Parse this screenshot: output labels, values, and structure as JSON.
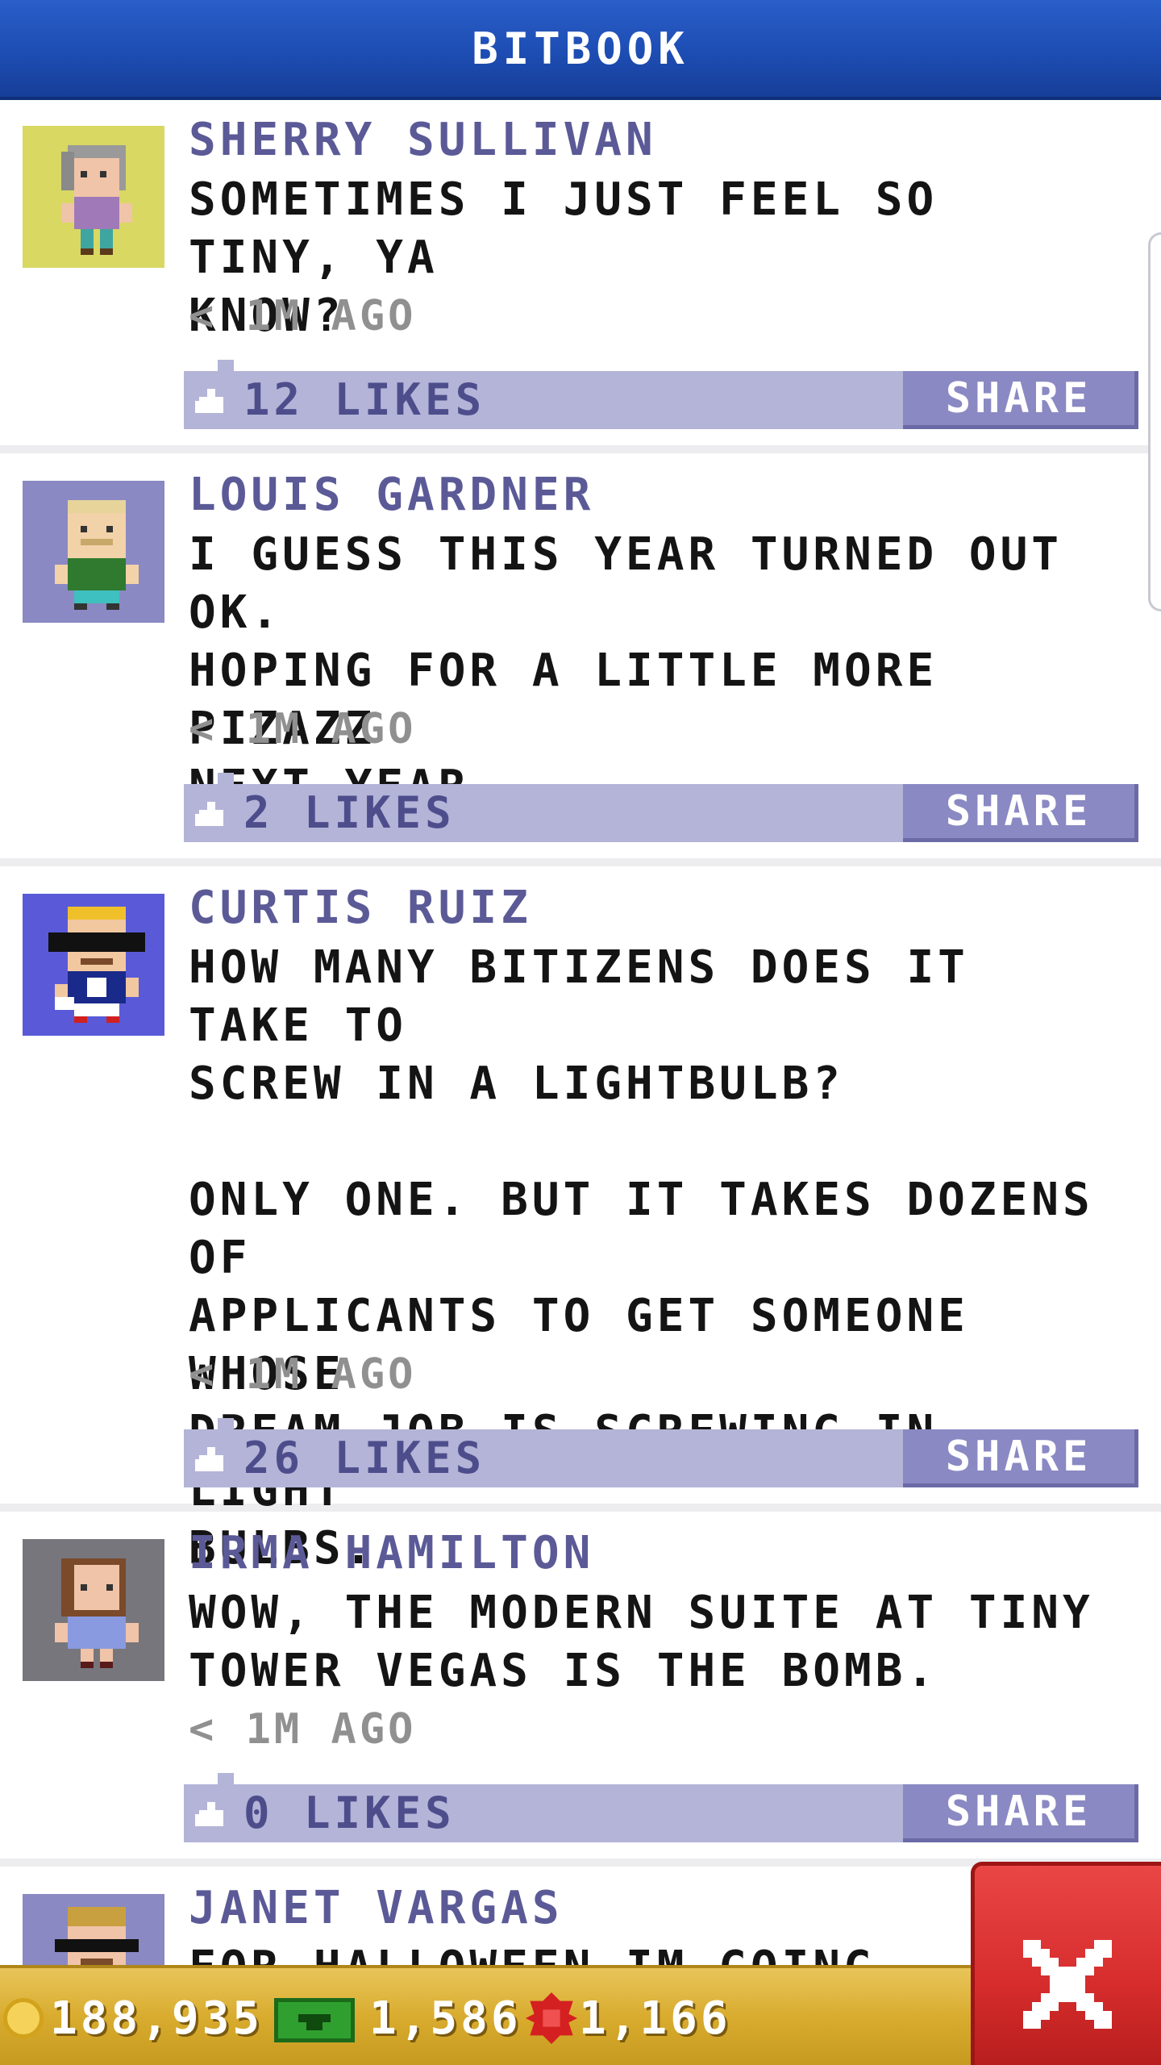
{
  "header": {
    "title": "BITBOOK"
  },
  "posts": [
    {
      "name": "SHERRY SULLIVAN",
      "text": "SOMETIMES I JUST FEEL SO TINY, YA\nKNOW?",
      "time": "< 1M AGO",
      "likes": "12 LIKES",
      "share": "SHARE",
      "avatar_bg": "#d8d863"
    },
    {
      "name": "LOUIS GARDNER",
      "text": "I GUESS THIS YEAR TURNED OUT OK.\nHOPING FOR A LITTLE MORE PIZAZZ\nNEXT YEAR.",
      "time": "< 1M AGO",
      "likes": "2 LIKES",
      "share": "SHARE",
      "avatar_bg": "#8a89c3"
    },
    {
      "name": "CURTIS RUIZ",
      "text": "HOW MANY BITIZENS DOES IT TAKE TO\nSCREW IN A LIGHTBULB?\n\nONLY ONE. BUT IT TAKES DOZENS OF\nAPPLICANTS TO GET SOMEONE WHOSE\nDREAM JOB IS SCREWING IN LIGHT\nBULBS.",
      "time": "< 1M AGO",
      "likes": "26 LIKES",
      "share": "SHARE",
      "avatar_bg": "#5a5ad8"
    },
    {
      "name": "IRMA HAMILTON",
      "text": "WOW, THE MODERN SUITE AT TINY\nTOWER VEGAS IS THE BOMB.",
      "time": "< 1M AGO",
      "likes": "0 LIKES",
      "share": "SHARE",
      "avatar_bg": "#77767d"
    },
    {
      "name": "JANET VARGAS",
      "text": "FOR HALLOWEEN IM GOING TO WE",
      "avatar_bg": "#8a89c3"
    }
  ],
  "currency": {
    "coins": "188,935",
    "bux": "1,586",
    "gems": "1,166"
  },
  "colors": {
    "header": "#1d4db3",
    "name": "#5b5a97",
    "like_bar": "#b4b4d8",
    "share_button": "#8a89c3",
    "bottom_bar": "#d9ac2f",
    "close_button": "#d62c2c"
  }
}
